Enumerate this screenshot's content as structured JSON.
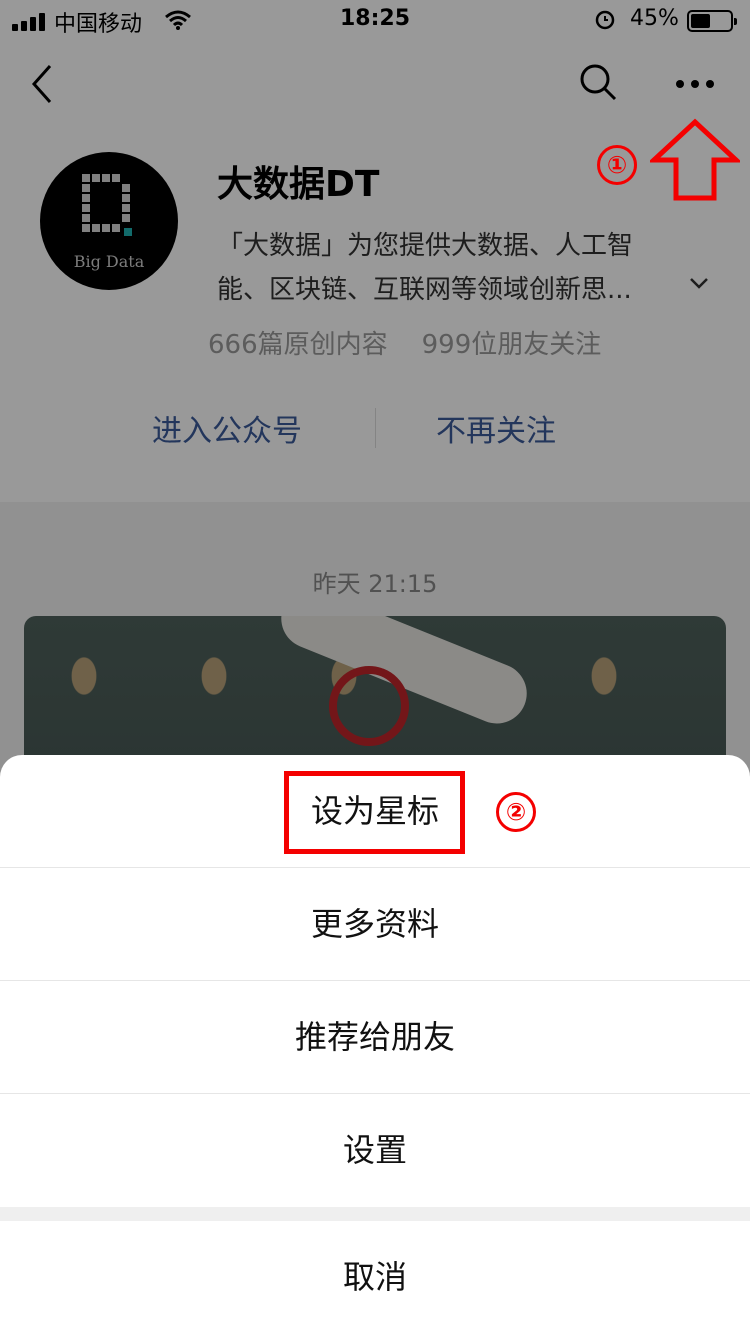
{
  "status_bar": {
    "carrier": "中国移动",
    "time": "18:25",
    "battery": "45%",
    "battery_level": 0.45
  },
  "nav": {
    "back_icon": "chevron-left-icon",
    "search_icon": "search-icon",
    "more_icon": "more-horizontal-icon"
  },
  "profile": {
    "avatar_text": "Big Data",
    "name": "大数据DT",
    "description": "「大数据」为您提供大数据、人工智能、区块链、互联网等领域创新思...",
    "stats": [
      "666篇原创内容",
      "999位朋友关注"
    ]
  },
  "actions": {
    "enter": "进入公众号",
    "unfollow": "不再关注"
  },
  "feed": {
    "time": "昨天 21:15"
  },
  "sheet": {
    "items": [
      "设为星标",
      "更多资料",
      "推荐给朋友",
      "设置"
    ],
    "cancel": "取消"
  },
  "annotations": {
    "step1": "①",
    "step2": "②",
    "color": "#f40000"
  }
}
